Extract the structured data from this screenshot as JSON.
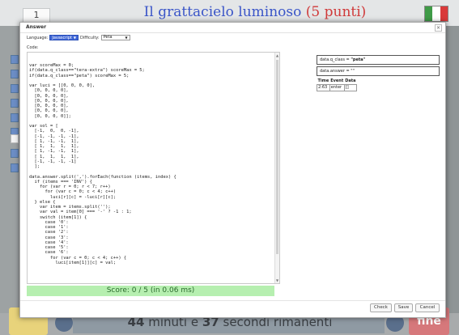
{
  "app": {
    "title": "Il grattacielo luminoso",
    "points": "(5 punti)",
    "task_number": "1",
    "flag_colors": [
      "#3f9b47",
      "#ffffff",
      "#d93a3a"
    ],
    "time_minutes": "44",
    "time_minutes_label": " minuti e ",
    "time_seconds": "37",
    "time_seconds_label": " secondi rimanenti",
    "end_button": "fine"
  },
  "modal": {
    "title": "Answer",
    "close_label": "×",
    "language_label": "Language:",
    "language_value": "Javascript",
    "difficulty_label": "Difficulty:",
    "difficulty_value": "Peta",
    "code_label": "Code:",
    "code": "var scoreMax = 0;\nif(data.q_class==\"tera-extra\") scoreMax = 5;\nif(data.q_class==\"peta\") scoreMax = 5;\n\nvar luci = [[0, 0, 0, 0],\n  [0, 0, 0, 0],\n  [0, 0, 0, 0],\n  [0, 0, 0, 0],\n  [0, 0, 0, 0],\n  [0, 0, 0, 0],\n  [0, 0, 0, 0]];\n\nvar sol = [\n  [-1,  0,  0, -1],\n  [-1, -1, -1, -1],\n  [ 1, -1, -1,  1],\n  [ 1,  1,  1,  1],\n  [ 1, -1, -1,  1],\n  [ 1,  1,  1,  1],\n  [-1, -1, -1, -1]\n  ];\n\ndata.answer.split(',').forEach(function (items, index) {\n  if (items === 'INV') {\n    for (var r = 0; r < 7; r++)\n      for (var c = 0; c < 4; c++)\n        luci[r][c] = -luci[r][c];\n  } else {\n    var item = items.split('');\n    var val = item[0] === '-' ? -1 : 1;\n    switch (item[1]) {\n      case '0':\n      case '1':\n      case '2':\n      case '3':\n      case '4':\n      case '5':\n      case '6':\n        for (var c = 0; c < 4; c++) {\n          luci[item[1]][c] = val;",
    "score_text": "Score: 0 / 5 (in 0.06 ms)",
    "q_class_prefix": "data.q_class = ",
    "q_class_value": "\"peta\"",
    "answer_field": "data.answer = \"\"",
    "event_table": {
      "headers": [
        "Time",
        "Event",
        "Data"
      ],
      "row": [
        "2:63",
        "enter",
        "[]"
      ]
    },
    "buttons": {
      "check": "Check",
      "save": "Save",
      "cancel": "Cancel"
    }
  }
}
